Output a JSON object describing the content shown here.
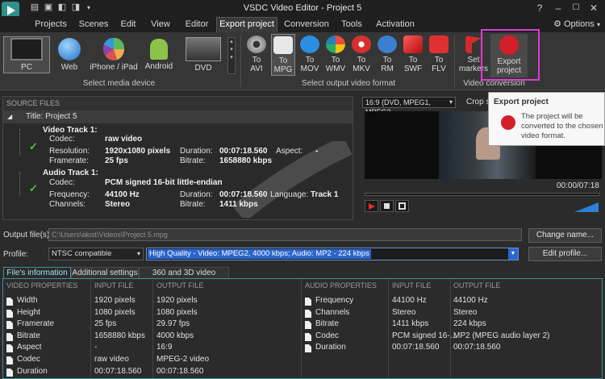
{
  "app": {
    "title": "VSDC Video Editor - Project 5",
    "options_label": "Options"
  },
  "menu": {
    "tabs": [
      "Projects",
      "Scenes",
      "Edit",
      "View",
      "Editor",
      "Export project",
      "Conversion",
      "Tools",
      "Activation"
    ],
    "active_index": 5
  },
  "ribbon": {
    "media_devices": [
      {
        "label": "PC",
        "icon": "pc-monitor-icon"
      },
      {
        "label": "Web",
        "icon": "globe-icon"
      },
      {
        "label": "iPhone / iPad",
        "icon": "apple-icon"
      },
      {
        "label": "Android",
        "icon": "android-icon"
      },
      {
        "label": "DVD",
        "icon": "dvd-icon"
      }
    ],
    "media_group_label": "Select media device",
    "formats": [
      {
        "label": "To\nAVI",
        "icon": "film-reel-icon",
        "color": "#9a9a9a"
      },
      {
        "label": "To\nMPG",
        "icon": "mpg-icon",
        "color": "#ffffff"
      },
      {
        "label": "To\nMOV",
        "icon": "quicktime-icon",
        "color": "#2a8fe0"
      },
      {
        "label": "To\nWMV",
        "icon": "windows-media-icon",
        "color": "#e0a030"
      },
      {
        "label": "To\nMKV",
        "icon": "mkv-icon",
        "color": "#d83030"
      },
      {
        "label": "To\nRM",
        "icon": "realmedia-icon",
        "color": "#3c7fd0"
      },
      {
        "label": "To\nSWF",
        "icon": "flash-icon",
        "color": "#d42020"
      },
      {
        "label": "To\nFLV",
        "icon": "flv-icon",
        "color": "#e03030"
      }
    ],
    "format_group_label": "Select output video format",
    "set_markers": "Set\nmarkers",
    "export_project": "Export\nproject",
    "conversion_group_label": "Video conversion"
  },
  "source": {
    "header": "SOURCE FILES",
    "title_row": "Title: Project 5",
    "video": {
      "heading": "Video Track 1:",
      "codec_label": "Codec:",
      "codec": "raw video",
      "resolution_label": "Resolution:",
      "resolution": "1920x1080 pixels",
      "duration_label": "Duration:",
      "duration": "00:07:18.560",
      "aspect_label": "Aspect:",
      "aspect": "-",
      "framerate_label": "Framerate:",
      "framerate": "25 fps",
      "bitrate_label": "Bitrate:",
      "bitrate": "1658880 kbps"
    },
    "audio": {
      "heading": "Audio Track 1:",
      "codec_label": "Codec:",
      "codec": "PCM signed 16-bit little-endian",
      "frequency_label": "Frequency:",
      "frequency": "44100 Hz",
      "duration_label": "Duration:",
      "duration": "00:07:18.560",
      "language_label": "Language:",
      "language": "Track 1",
      "channels_label": "Channels:",
      "channels": "Stereo",
      "bitrate_label": "Bitrate:",
      "bitrate": "1411 kbps"
    }
  },
  "preview": {
    "aspect_value": "16:9 (DVD, MPEG1, MPEG2",
    "crop_label": "Crop sc",
    "timecode": "00:00/07:18",
    "tooltip_title": "Export project",
    "tooltip_body": "The project will be converted to the chosen video format."
  },
  "output": {
    "files_label": "Output file(s):",
    "file_path": "C:\\Users\\akist\\Videos\\Project 5.mpg",
    "change_name": "Change name...",
    "profile_label": "Profile:",
    "profile_value": "NTSC compatible",
    "quality_value": "High Quality - Video: MPEG2, 4000 kbps; Audio: MP2 - 224 kbps",
    "edit_profile": "Edit profile..."
  },
  "info": {
    "tabs": [
      "File's information",
      "Additional settings",
      "360 and 3D video settings"
    ],
    "video_headers": [
      "VIDEO PROPERTIES",
      "INPUT FILE",
      "OUTPUT FILE"
    ],
    "video_rows": [
      [
        "Width",
        "1920 pixels",
        "1920 pixels"
      ],
      [
        "Height",
        "1080 pixels",
        "1080 pixels"
      ],
      [
        "Framerate",
        "25 fps",
        "29.97 fps"
      ],
      [
        "Bitrate",
        "1658880 kbps",
        "4000 kbps"
      ],
      [
        "Aspect",
        "-",
        "16:9"
      ],
      [
        "Codec",
        "raw video",
        "MPEG-2 video"
      ],
      [
        "Duration",
        "00:07:18.560",
        "00:07:18.560"
      ]
    ],
    "audio_headers": [
      "AUDIO PROPERTIES",
      "INPUT FILE",
      "OUTPUT FILE"
    ],
    "audio_rows": [
      [
        "Frequency",
        "44100 Hz",
        "44100 Hz"
      ],
      [
        "Channels",
        "Stereo",
        "Stereo"
      ],
      [
        "Bitrate",
        "1411 kbps",
        "224 kbps"
      ],
      [
        "Codec",
        "PCM signed 16-...",
        "MP2 (MPEG audio layer 2)"
      ],
      [
        "Duration",
        "00:07:18.560",
        "00:07:18.560"
      ]
    ]
  }
}
